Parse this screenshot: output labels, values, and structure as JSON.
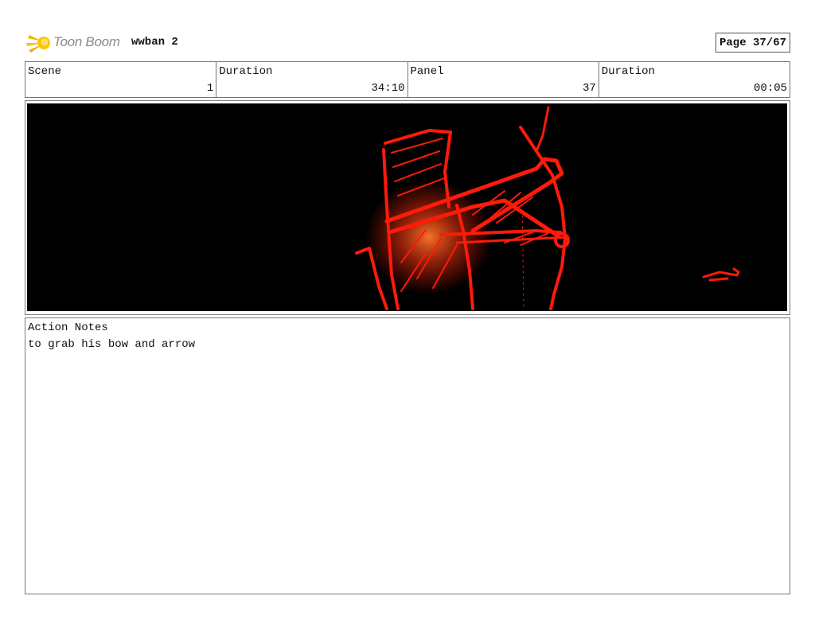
{
  "header": {
    "logo_text": "Toon Boom",
    "project_title": "wwban 2",
    "page_label": "Page 37/67"
  },
  "info": {
    "scene_label": "Scene",
    "scene_value": "1",
    "scene_duration_label": "Duration",
    "scene_duration_value": "34:10",
    "panel_label": "Panel",
    "panel_value": "37",
    "panel_duration_label": "Duration",
    "panel_duration_value": "00:05"
  },
  "panel": {
    "background_color": "#000000",
    "sketch_color": "#ff1a0a",
    "glow_color": "#ff6a1a"
  },
  "notes": {
    "label": "Action Notes",
    "text": "to grab his bow and arrow"
  }
}
